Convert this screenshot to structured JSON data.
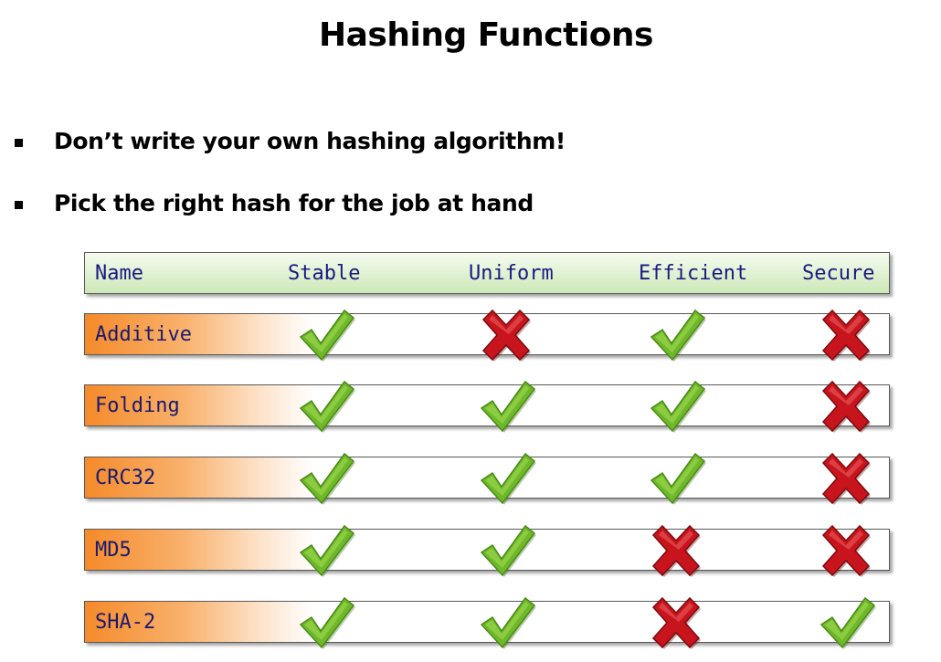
{
  "slide": {
    "title": "Hashing Functions",
    "bullets": [
      "Don’t write your own hashing algorithm!",
      "Pick the right hash for the job at hand"
    ]
  },
  "table": {
    "headers": [
      "Name",
      "Stable",
      "Uniform",
      "Efficient",
      "Secure"
    ],
    "rows": [
      {
        "name": "Additive",
        "stable": true,
        "uniform": false,
        "efficient": true,
        "secure": false
      },
      {
        "name": "Folding",
        "stable": true,
        "uniform": true,
        "efficient": true,
        "secure": false
      },
      {
        "name": "CRC32",
        "stable": true,
        "uniform": true,
        "efficient": true,
        "secure": false
      },
      {
        "name": "MD5",
        "stable": true,
        "uniform": true,
        "efficient": false,
        "secure": false
      },
      {
        "name": "SHA-2",
        "stable": true,
        "uniform": true,
        "efficient": false,
        "secure": true
      }
    ]
  },
  "colors": {
    "check": "#6fb82a",
    "cross": "#c8141c",
    "header_bg": "#cde8b8",
    "row_accent": "#f58a2a",
    "label_text": "#1a1a80"
  },
  "icons": {
    "yes": "check-icon",
    "no": "cross-icon"
  }
}
